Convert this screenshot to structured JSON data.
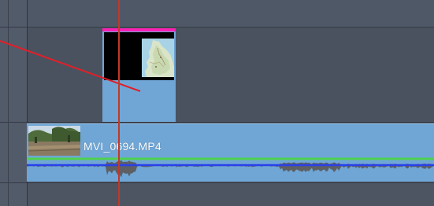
{
  "timeline": {
    "video_clip": {
      "filename": "MVI_0694.MP4"
    },
    "overlay_clip": {
      "icons": [
        "map-thumbnail-icon"
      ]
    },
    "colors": {
      "playhead": "#c0392b",
      "overlay_marker": "#ff1fb4",
      "audio_volume_line": "#2a40e8",
      "video_top_line": "#4fd14f",
      "connector": "#e0202a",
      "clip_body": "#6fa6d6"
    }
  }
}
